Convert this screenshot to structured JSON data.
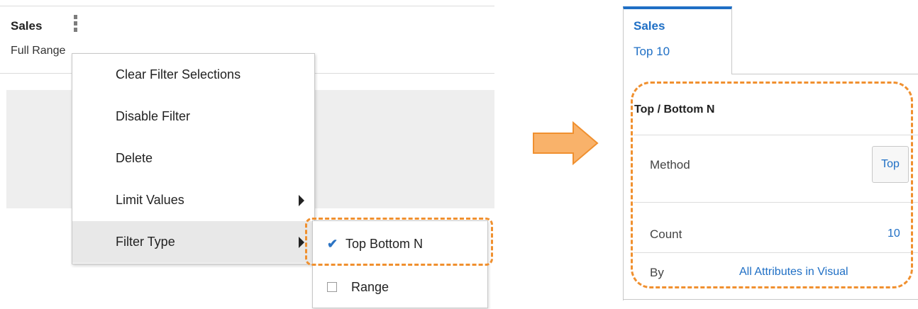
{
  "left": {
    "filter_title": "Sales",
    "filter_range": "Full Range",
    "context_menu": [
      {
        "label": "Clear Filter Selections",
        "submenu": false,
        "active": false
      },
      {
        "label": "Disable Filter",
        "submenu": false,
        "active": false
      },
      {
        "label": "Delete",
        "submenu": false,
        "active": false
      },
      {
        "label": "Limit Values",
        "submenu": true,
        "active": false
      },
      {
        "label": "Filter Type",
        "submenu": true,
        "active": true
      }
    ],
    "submenu": [
      {
        "label": "Top Bottom N",
        "checked": true
      },
      {
        "label": "Range",
        "checked": false
      }
    ]
  },
  "right": {
    "tab_title": "Sales",
    "tab_subtitle": "Top 10",
    "section_title": "Top / Bottom N",
    "method_label": "Method",
    "method_value": "Top",
    "count_label": "Count",
    "count_value": "10",
    "by_label": "By",
    "by_value": "All Attributes in Visual"
  },
  "icons": {
    "kebab": "kebab-menu-icon",
    "submenu_arrow": "triangle-right-icon",
    "check": "checkmark-icon",
    "checkbox": "checkbox-icon",
    "transition_arrow": "arrow-right-icon"
  },
  "colors": {
    "accent_blue": "#1f6fc5",
    "highlight_orange": "#f0902f",
    "arrow_fill": "#f9b26a",
    "menu_active": "#e8e8e8"
  }
}
